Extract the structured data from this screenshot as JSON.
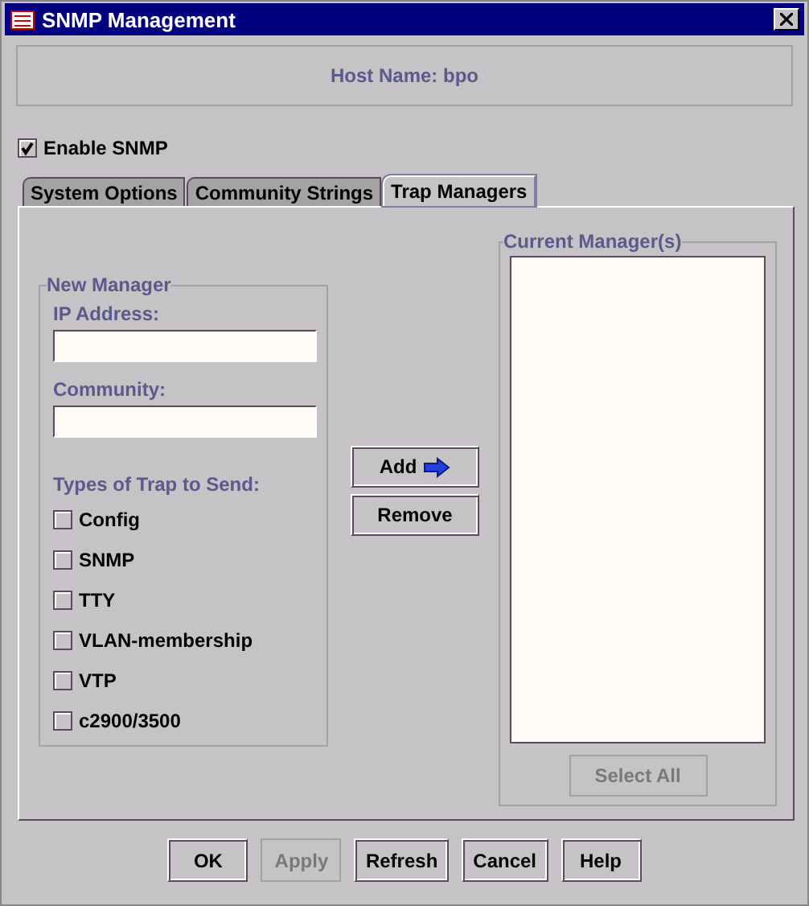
{
  "window": {
    "title": "SNMP Management"
  },
  "host_name": "Host Name: bpo",
  "enable_snmp": {
    "label": "Enable SNMP",
    "checked": true
  },
  "tabs": [
    {
      "label": "System Options",
      "selected": false
    },
    {
      "label": "Community Strings",
      "selected": false
    },
    {
      "label": "Trap Managers",
      "selected": true
    }
  ],
  "new_manager": {
    "title": "New Manager",
    "ip_label": "IP Address:",
    "community_label": "Community:",
    "traps_label": "Types of Trap to Send:",
    "traps": [
      {
        "label": "Config",
        "checked": false
      },
      {
        "label": "SNMP",
        "checked": false
      },
      {
        "label": "TTY",
        "checked": false
      },
      {
        "label": "VLAN-membership",
        "checked": false
      },
      {
        "label": "VTP",
        "checked": false
      },
      {
        "label": "c2900/3500",
        "checked": false
      }
    ]
  },
  "add_button": "Add",
  "remove_button": "Remove",
  "current_managers": {
    "title": "Current Manager(s)",
    "select_all": {
      "label": "Select All",
      "disabled": true
    }
  },
  "buttons": [
    {
      "label": "OK",
      "disabled": false
    },
    {
      "label": "Apply",
      "disabled": true
    },
    {
      "label": "Refresh",
      "disabled": false
    },
    {
      "label": "Cancel",
      "disabled": false
    },
    {
      "label": "Help",
      "disabled": false
    }
  ]
}
